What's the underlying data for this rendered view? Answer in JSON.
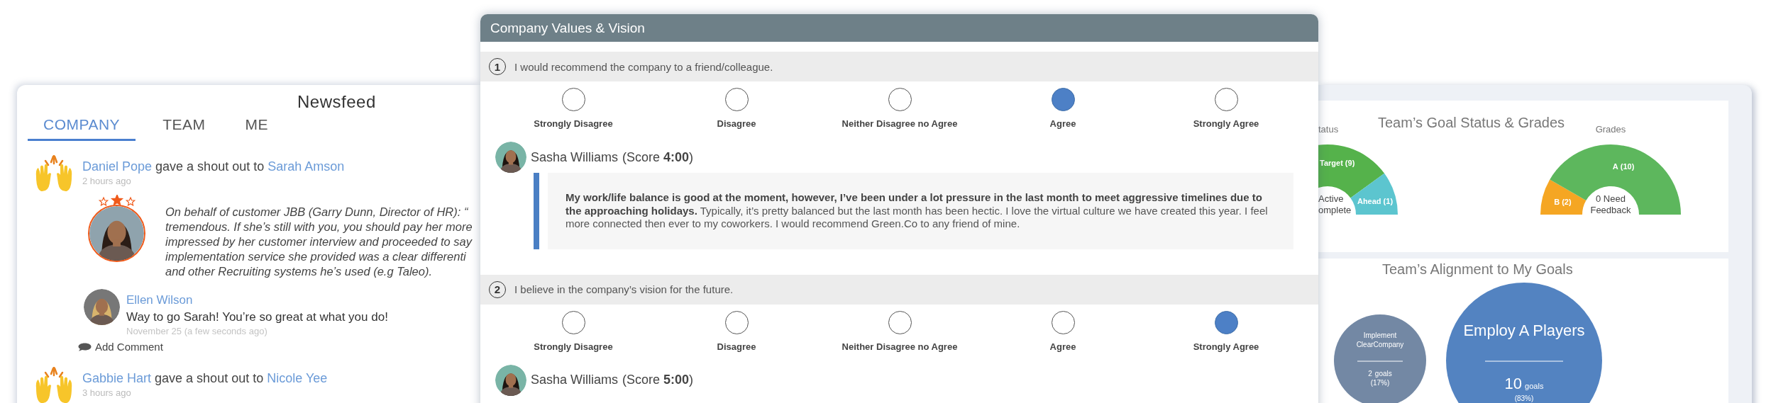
{
  "newsfeed": {
    "title": "Newsfeed",
    "tabs": [
      {
        "label": "COMPANY",
        "selected": true
      },
      {
        "label": "TEAM",
        "selected": false
      },
      {
        "label": "ME",
        "selected": false
      }
    ],
    "posts": [
      {
        "author": "Daniel Pope",
        "action": "gave a shout out to",
        "recipient": "Sarah Amson",
        "time": "2 hours ago",
        "photo": {
          "kind": "picture"
        },
        "quote_lines": [
          "On behalf of customer JBB (Garry Dunn, Director of HR): “",
          "tremendous. If she’s still with you, you should pay her more",
          "impressed by her customer interview and proceeded to say",
          "implementation service she provided was a clear differenti",
          "and other Recruiting systems he’s used (e.g Taleo)."
        ],
        "comments": [
          {
            "author": "Ellen Wilson",
            "text": "Way to go Sarah! You’re so great at what you do!",
            "time": "November 25 (a few seconds ago)"
          }
        ],
        "add_comment": "Add Comment"
      },
      {
        "author": "Gabbie Hart",
        "action": "gave a shout out to",
        "recipient": "Nicole Yee",
        "time": "3 hours ago"
      }
    ]
  },
  "survey": {
    "title": "Company Values & Vision",
    "questions": [
      {
        "number": "1",
        "text": "I would recommend the company to a friend/colleague.",
        "options": [
          {
            "label": "Strongly Disagree",
            "selected": false
          },
          {
            "label": "Disagree",
            "selected": false
          },
          {
            "label": "Neither Disagree no Agree",
            "selected": false
          },
          {
            "label": "Agree",
            "selected": true
          },
          {
            "label": "Strongly Agree",
            "selected": false
          }
        ],
        "response": {
          "name": "Sasha Williams",
          "score": "(Score **4:00**)",
          "answer": "**My work/life balance is good at the moment, however, I’ve been under a lot pressure in the last month to meet aggressive timelines due to the approaching holidays.** Typically, it’s pretty balanced but the last month has been hectic. I love the virtual culture we have created this year. I feel more connected then ever to my coworkers. I would recommend Green.Co to any friend of mine."
        }
      },
      {
        "number": "2",
        "text": "I believe in the company’s vision for the future.",
        "options": [
          {
            "label": "Strongly Disagree",
            "selected": false
          },
          {
            "label": "Disagree",
            "selected": false
          },
          {
            "label": "Neither Disagree no Agree",
            "selected": false
          },
          {
            "label": "Agree",
            "selected": false
          },
          {
            "label": "Strongly Agree",
            "selected": true
          }
        ],
        "response": {
          "name": "Sasha Williams",
          "score": "(Score **5:00**)"
        }
      }
    ]
  },
  "goals": {
    "title": "Team’s Goal Status & Grades",
    "status_chart": {
      "title": "tatus",
      "segments": [
        {
          "label": "Target (9)",
          "color": "#55b24b"
        },
        {
          "label": "Ahead (1)",
          "color": "#5cc5cf"
        }
      ],
      "center_lines": [
        "Active",
        "omplete"
      ]
    },
    "grades_chart": {
      "chart_data": {
        "type": "donut",
        "title": "Grades",
        "categories": [
          "B",
          "A"
        ],
        "values": [
          2,
          10
        ],
        "value_labels": [
          "(2)",
          "(10)"
        ],
        "colors": [
          "#f5a623",
          "#5db75d"
        ],
        "data_labels": true
      },
      "center_lines": [
        "0 Need",
        "Feedback"
      ]
    },
    "alignment": {
      "title": "Team’s Alignment to My Goals",
      "bubbles": [
        {
          "kind": "minor",
          "title_lines": [
            "Implement",
            "ClearCompany"
          ],
          "count": "2",
          "unit": "goals",
          "share": "(17%)",
          "color": "#7388a4"
        },
        {
          "kind": "major",
          "title_lines": [
            "Employ A Players"
          ],
          "count": "10",
          "unit": "goals",
          "share": "(83%)",
          "color": "#5383c1"
        }
      ]
    }
  }
}
